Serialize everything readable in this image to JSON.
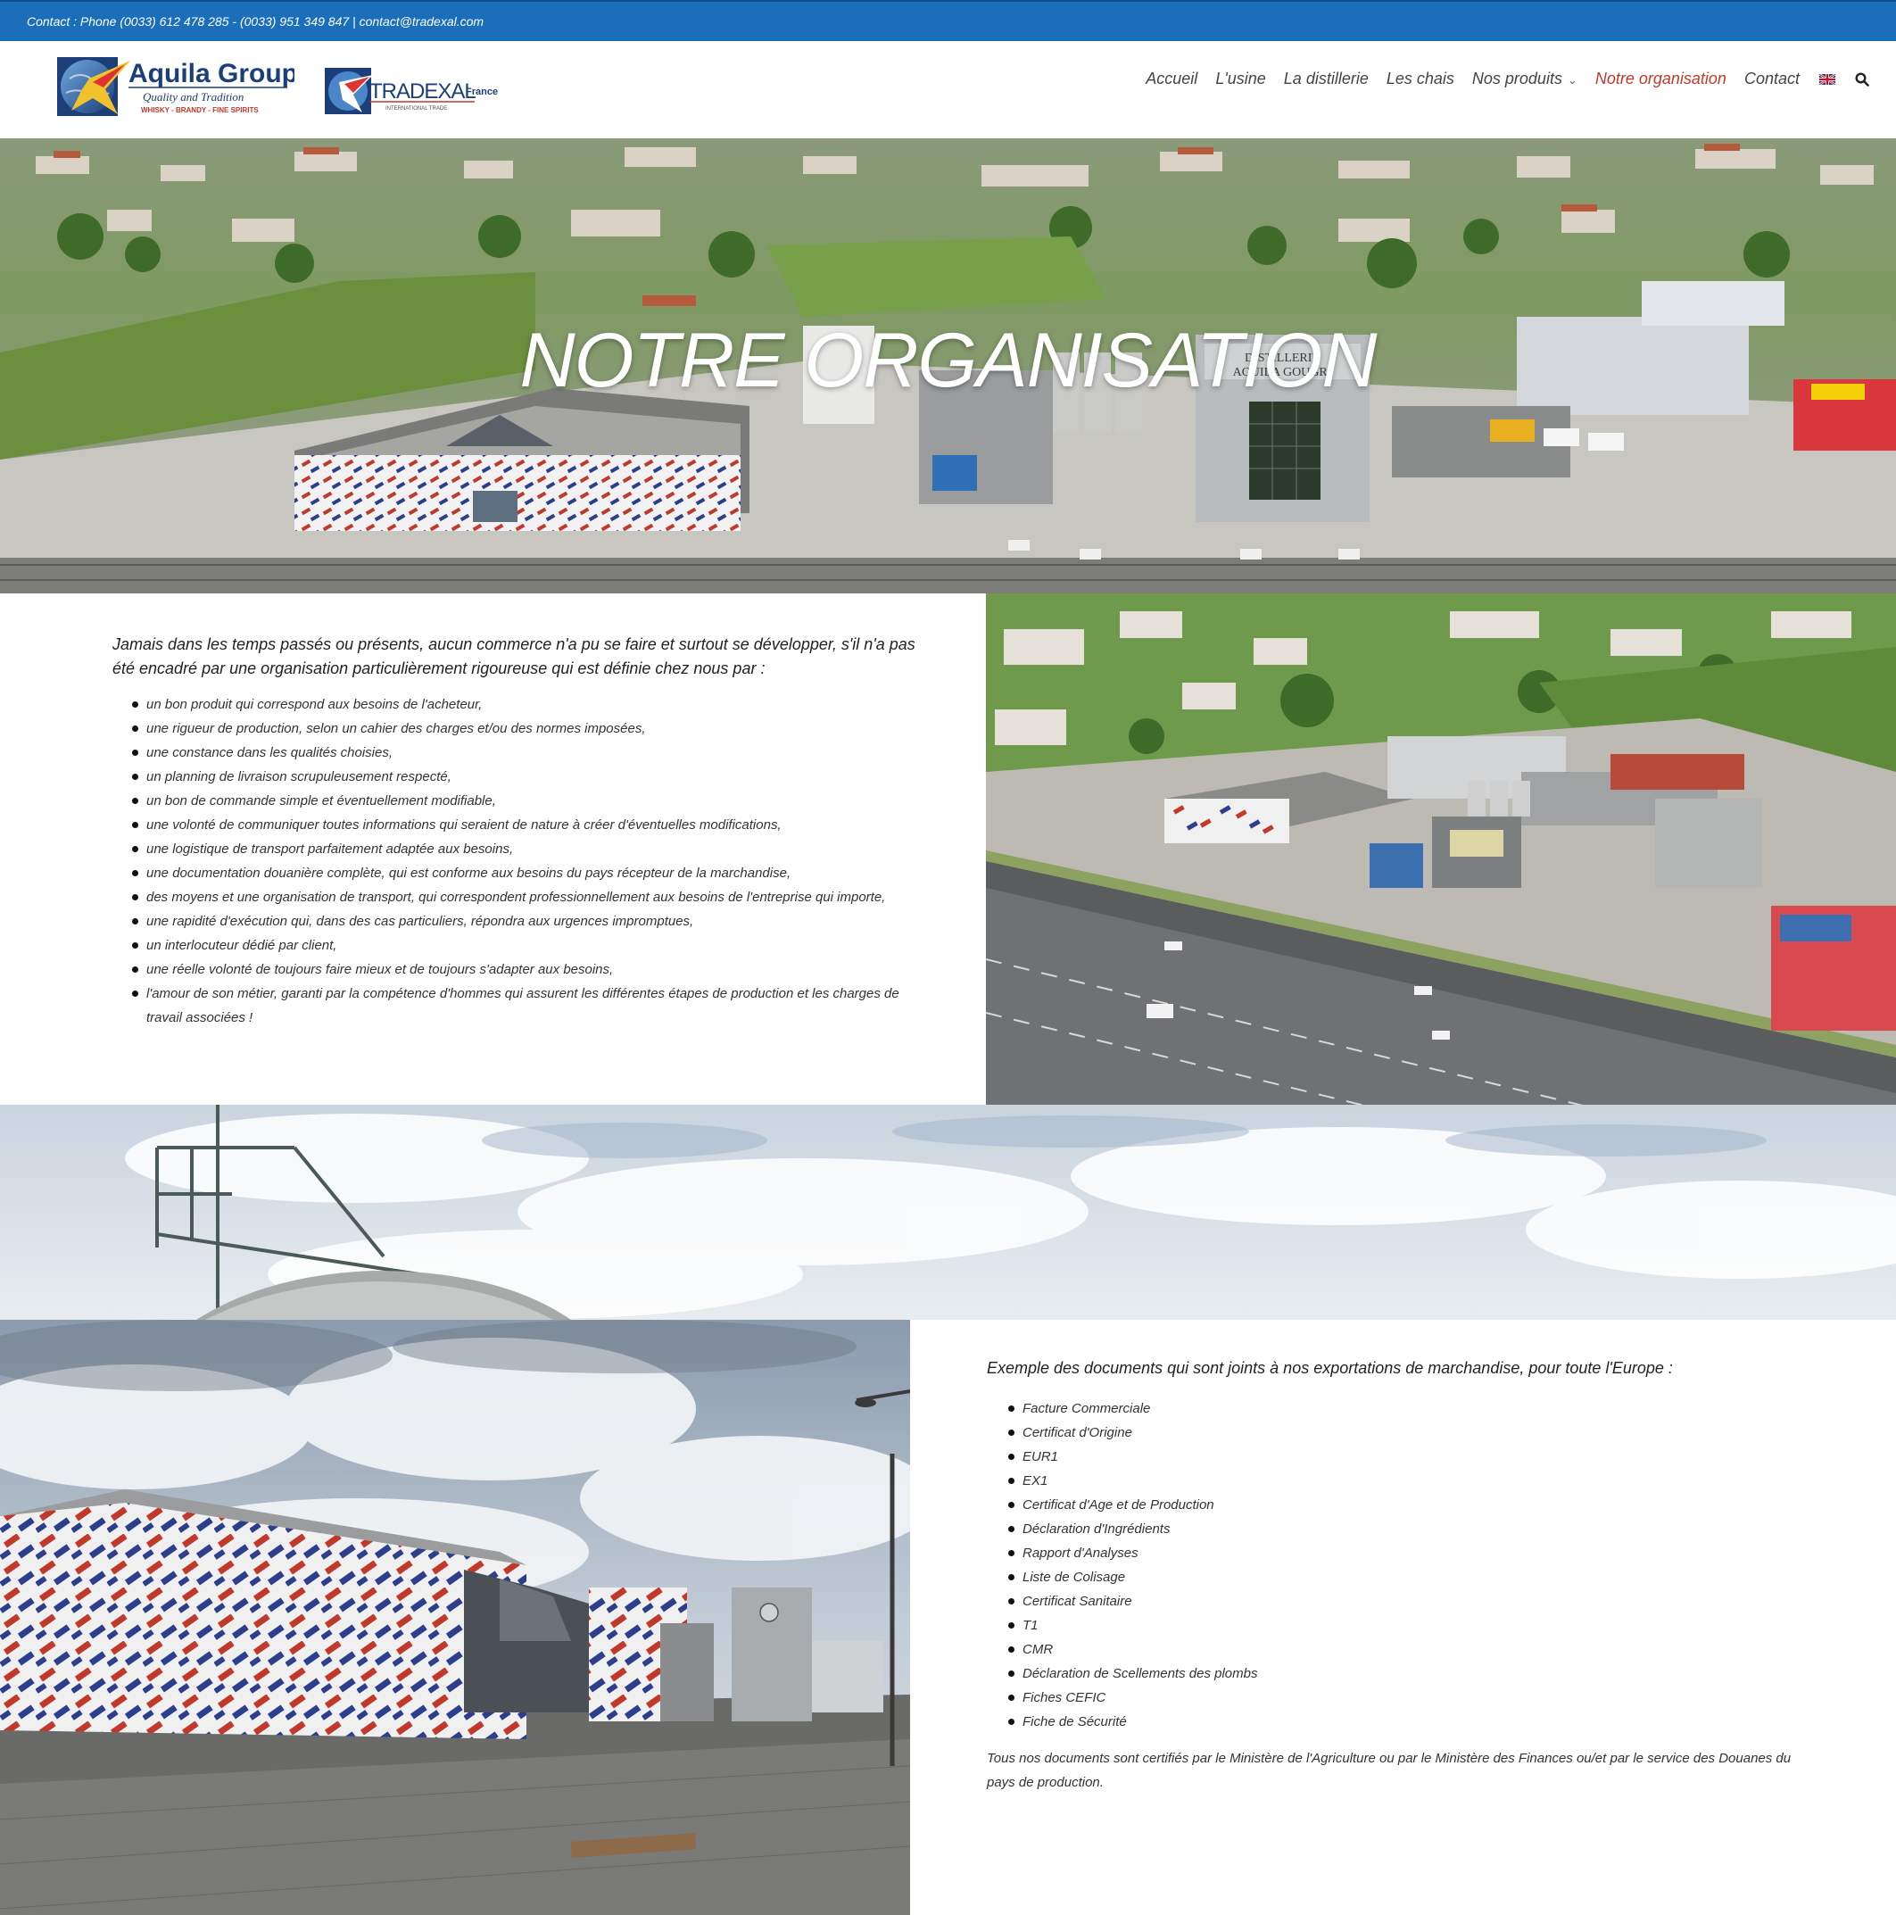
{
  "topbar": {
    "contact": "Contact : Phone (0033) 612 478 285 - (0033) 951 349 847  |  contact@tradexal.com"
  },
  "logos": {
    "aquila_name": "Aquila Group",
    "aquila_tagline": "Quality and Tradition",
    "aquila_products": "WHISKY - BRANDY - FINE SPIRITS",
    "tradexal_name": "TRADEXAL",
    "tradexal_country": "France",
    "tradexal_sub": "INTERNATIONAL TRADE"
  },
  "nav": {
    "items": [
      {
        "label": "Accueil"
      },
      {
        "label": "L'usine"
      },
      {
        "label": "La distillerie"
      },
      {
        "label": "Les chais"
      },
      {
        "label": "Nos produits"
      },
      {
        "label": "Notre organisation",
        "active": true
      },
      {
        "label": "Contact"
      }
    ],
    "language_flag": "uk-flag-icon",
    "search_icon": "search-icon"
  },
  "hero": {
    "title": "NOTRE ORGANISATION",
    "building_sign_line1": "DISTILLERIE",
    "building_sign_line2": "AQUILA GOUGRI"
  },
  "section1": {
    "intro": "Jamais dans les temps passés ou présents, aucun commerce n'a pu se faire et surtout se développer, s'il n'a pas été encadré par une organisation particulièrement rigoureuse qui est définie chez nous par :",
    "items": [
      "un bon produit qui correspond aux besoins de l'acheteur,",
      "une rigueur de production, selon un cahier des charges et/ou des normes imposées,",
      "une constance dans les qualités choisies,",
      "un planning de livraison scrupuleusement respecté,",
      "un bon de commande simple et éventuellement modifiable,",
      "une volonté de communiquer toutes informations qui seraient de nature à créer d'éventuelles modifications,",
      "une logistique de transport parfaitement adaptée aux besoins,",
      "une documentation douanière complète, qui est conforme aux besoins du pays récepteur de la marchandise,",
      "des moyens et une organisation de transport, qui correspondent professionnellement aux besoins de l'entreprise qui importe,",
      "une rapidité d'exécution qui, dans des cas particuliers, répondra aux urgences impromptues,",
      "un interlocuteur dédié par client,",
      "une réelle volonté de toujours faire mieux et de toujours s'adapter aux besoins,",
      "l'amour de son métier, garanti par la compétence d'hommes qui assurent les différentes étapes de production et les charges de travail associées !"
    ]
  },
  "section2": {
    "intro": "Exemple des documents qui sont joints à nos exportations de marchandise, pour toute l'Europe :",
    "items": [
      "Facture Commerciale",
      "Certificat d'Origine",
      "EUR1",
      "EX1",
      "Certificat d'Age et de Production",
      "Déclaration d'Ingrédients",
      "Rapport d'Analyses",
      "Liste de Colisage",
      "Certificat Sanitaire",
      "T1",
      "CMR",
      "Déclaration de Scellements des plombs",
      "Fiches CEFIC",
      "Fiche de Sécurité"
    ],
    "note": "Tous nos documents sont certifiés par le Ministère de l'Agriculture ou par le Ministère des Finances ou/et par le service des Douanes du pays de production."
  },
  "colors": {
    "topbar": "#1b6fba",
    "active_nav": "#c0392b",
    "text": "#333333"
  }
}
